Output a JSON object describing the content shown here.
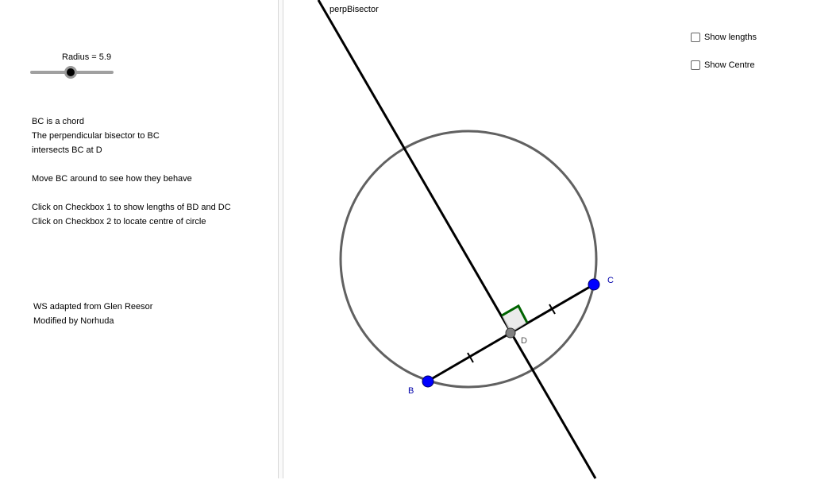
{
  "slider": {
    "label": "Radius = 5.9",
    "value": 5.9
  },
  "instructions": {
    "lines": [
      "BC is a chord",
      "The perpendicular bisector to BC",
      "intersects BC at D",
      "Move BC around to see how they behave",
      "Click on Checkbox 1 to show lengths of BD and DC",
      "Click on Checkbox 2 to locate centre of circle"
    ]
  },
  "credits": {
    "line1": "WS adapted from Glen Reesor",
    "line2": "Modified by Norhuda"
  },
  "checkboxes": [
    {
      "label": "Show lengths",
      "checked": false
    },
    {
      "label": "Show Centre",
      "checked": false
    }
  ],
  "graphics": {
    "line_label": "perpBisector",
    "point_b_label": "B",
    "point_c_label": "C",
    "point_d_label": "D",
    "colors": {
      "circle": "#616161",
      "point": "#0000ff",
      "midpoint": "#808080",
      "right_angle": "#006400",
      "label_blue": "#0000aa"
    }
  }
}
